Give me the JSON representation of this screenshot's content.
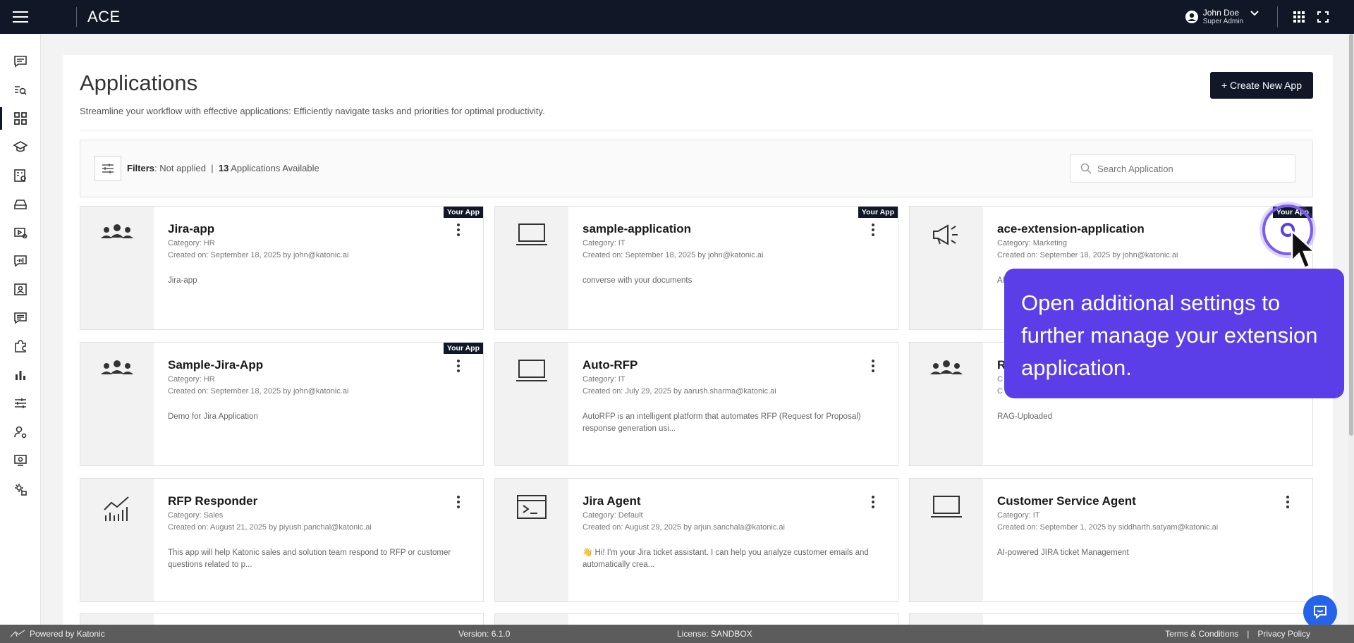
{
  "app": {
    "brand": "ACE"
  },
  "user": {
    "name": "John Doe",
    "role": "Super Admin"
  },
  "page": {
    "title": "Applications",
    "description": "Streamline your workflow with effective applications: Efficiently navigate tasks and priorities for optimal productivity.",
    "create_label": "+ Create New App"
  },
  "filters": {
    "label": "Filters",
    "value": ": Not applied",
    "separator": "|",
    "count": "13",
    "count_label": "Applications Available"
  },
  "search": {
    "placeholder": "Search Application"
  },
  "cards": [
    {
      "title": "Jira-app",
      "category": "Category: HR",
      "created": "Created on: September 18, 2025 by john@katonic.ai",
      "desc": "Jira-app",
      "badge": "Your App",
      "icon": "people-group-icon"
    },
    {
      "title": "sample-application",
      "category": "Category: IT",
      "created": "Created on: September 18, 2025 by john@katonic.ai",
      "desc": "converse with your documents",
      "badge": "Your App",
      "icon": "laptop-icon"
    },
    {
      "title": "ace-extension-application",
      "category": "Category: Marketing",
      "created": "Created on: September 18, 2025 by john@katonic.ai",
      "desc": "AI",
      "badge": "Your App",
      "icon": "megaphone-icon"
    },
    {
      "title": "Sample-Jira-App",
      "category": "Category: HR",
      "created": "Created on: September 18, 2025 by john@katonic.ai",
      "desc": "Demo for Jira Application",
      "badge": "Your App",
      "icon": "people-group-icon"
    },
    {
      "title": "Auto-RFP",
      "category": "Category: IT",
      "created": "Created on: July 29, 2025 by aarush.sharma@katonic.ai",
      "desc": "AutoRFP is an intelligent platform that automates RFP (Request for Proposal) response generation usi...",
      "badge": "",
      "icon": "laptop-icon"
    },
    {
      "title": "R",
      "category": "C",
      "created": "C",
      "desc": "RAG-Uploaded",
      "badge": "",
      "icon": "people-group-icon"
    },
    {
      "title": "RFP Responder",
      "category": "Category: Sales",
      "created": "Created on: August 21, 2025 by piyush.panchal@katonic.ai",
      "desc": "This app will help Katonic sales and solution team respond to RFP or customer questions related to p...",
      "badge": "",
      "icon": "chart-icon"
    },
    {
      "title": "Jira Agent",
      "category": "Category: Default",
      "created": "Created on: August 29, 2025 by arjun.sanchala@katonic.ai",
      "desc": "👋 Hi! I'm your Jira ticket assistant. I can help you analyze customer emails and automatically crea...",
      "badge": "",
      "icon": "terminal-icon"
    },
    {
      "title": "Customer Service Agent",
      "category": "Category: IT",
      "created": "Created on: September 1, 2025 by siddharth.satyam@katonic.ai",
      "desc": "AI-powered JIRA ticket Management",
      "badge": "",
      "icon": "laptop-icon"
    }
  ],
  "tooltip": {
    "text": "Open additional settings to further manage your extension application."
  },
  "footer": {
    "powered": "Powered by Katonic",
    "version": "Version: 6.1.0",
    "license": "License: SANDBOX",
    "terms": "Terms & Conditions",
    "sep": "|",
    "privacy": "Privacy Policy"
  },
  "colors": {
    "navy": "#101828",
    "accent": "#5b3ee8",
    "chat": "#2563eb"
  }
}
